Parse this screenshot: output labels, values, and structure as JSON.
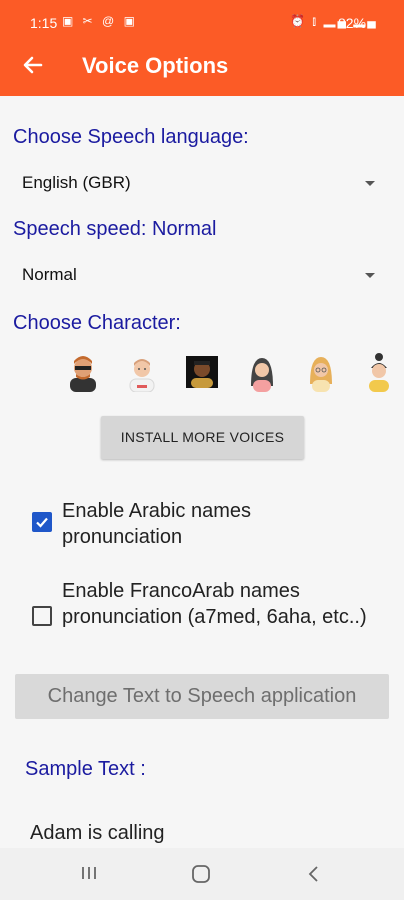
{
  "status_bar": {
    "time": "1:15",
    "left_icons": [
      "gallery-icon",
      "tools-icon",
      "at-icon",
      "image-icon"
    ],
    "right_icons": [
      "alarm-icon",
      "vibrate-icon",
      "signal-icon",
      "signal-icon"
    ],
    "battery": "82%"
  },
  "app_bar": {
    "title": "Voice Options",
    "color": "#fc5b26"
  },
  "language": {
    "label": "Choose Speech language:",
    "selected": "English (GBR)"
  },
  "speed": {
    "label": "Speech speed: Normal",
    "selected": "Normal"
  },
  "character": {
    "label": "Choose Character:",
    "avatars": [
      "man-sunglasses-avatar",
      "boy-avatar",
      "dark-man-avatar",
      "woman-dark-hair-avatar",
      "woman-blonde-avatar",
      "woman-bun-avatar"
    ]
  },
  "install_button": "INSTALL MORE VOICES",
  "options": [
    {
      "label": "Enable Arabic names pronunciation",
      "checked": true
    },
    {
      "label": "Enable FrancoArab names pronunciation (a7med, 6aha, etc..)",
      "checked": false
    }
  ],
  "tts_button": "Change Text to Speech application",
  "sample": {
    "label": "Sample Text :",
    "text": "Adam is calling"
  }
}
